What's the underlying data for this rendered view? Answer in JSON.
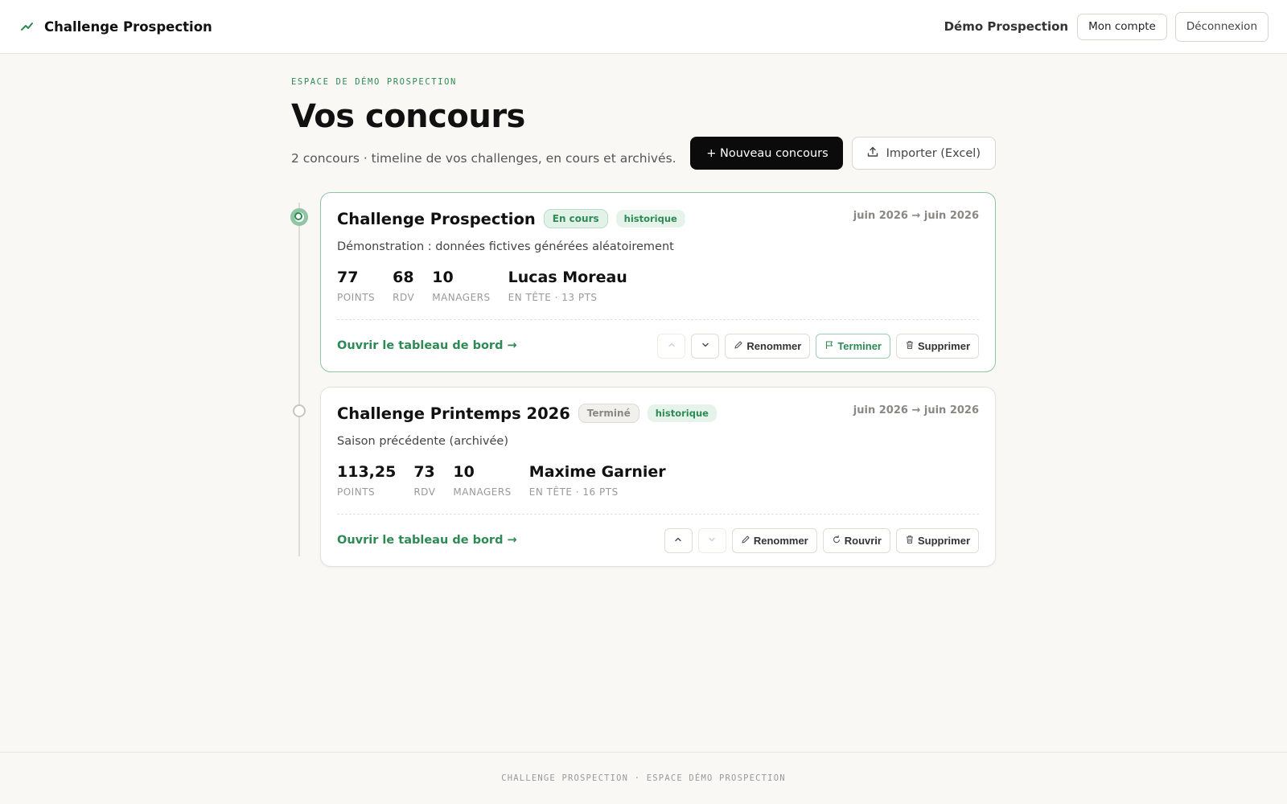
{
  "header": {
    "brand": "Challenge Prospection",
    "user": "Démo Prospection",
    "account_label": "Mon compte",
    "logout_label": "Déconnexion"
  },
  "main": {
    "eyebrow": "ESPACE DE DÉMO PROSPECTION",
    "title": "Vos concours",
    "subtitle": "2 concours · timeline de vos challenges, en cours et archivés.",
    "new_label": "+ Nouveau concours",
    "import_label": "Importer (Excel)"
  },
  "contests": [
    {
      "title": "Challenge Prospection",
      "status": "En cours",
      "tag": "historique",
      "dates": "juin 2026 → juin 2026",
      "description": "Démonstration : données fictives générées aléatoirement",
      "points": "77",
      "points_label": "POINTS",
      "rdv": "68",
      "rdv_label": "RDV",
      "managers": "10",
      "managers_label": "MANAGERS",
      "leader": "Lucas Moreau",
      "leader_label": "EN TÊTE · 13 PTS",
      "open_label": "Ouvrir le tableau de bord →",
      "rename_label": "Renommer",
      "action_label": "Terminer",
      "delete_label": "Supprimer"
    },
    {
      "title": "Challenge Printemps 2026",
      "status": "Terminé",
      "tag": "historique",
      "dates": "juin 2026 → juin 2026",
      "description": "Saison précédente (archivée)",
      "points": "113,25",
      "points_label": "POINTS",
      "rdv": "73",
      "rdv_label": "RDV",
      "managers": "10",
      "managers_label": "MANAGERS",
      "leader": "Maxime Garnier",
      "leader_label": "EN TÊTE · 16 PTS",
      "open_label": "Ouvrir le tableau de bord →",
      "rename_label": "Renommer",
      "action_label": "Rouvrir",
      "delete_label": "Supprimer"
    }
  ],
  "footer": {
    "text": "CHALLENGE PROSPECTION · ESPACE DÉMO PROSPECTION"
  },
  "colors": {
    "accent": "#2e8a55",
    "primary_button": "#0b0b0b",
    "background": "#f9f8f5"
  }
}
